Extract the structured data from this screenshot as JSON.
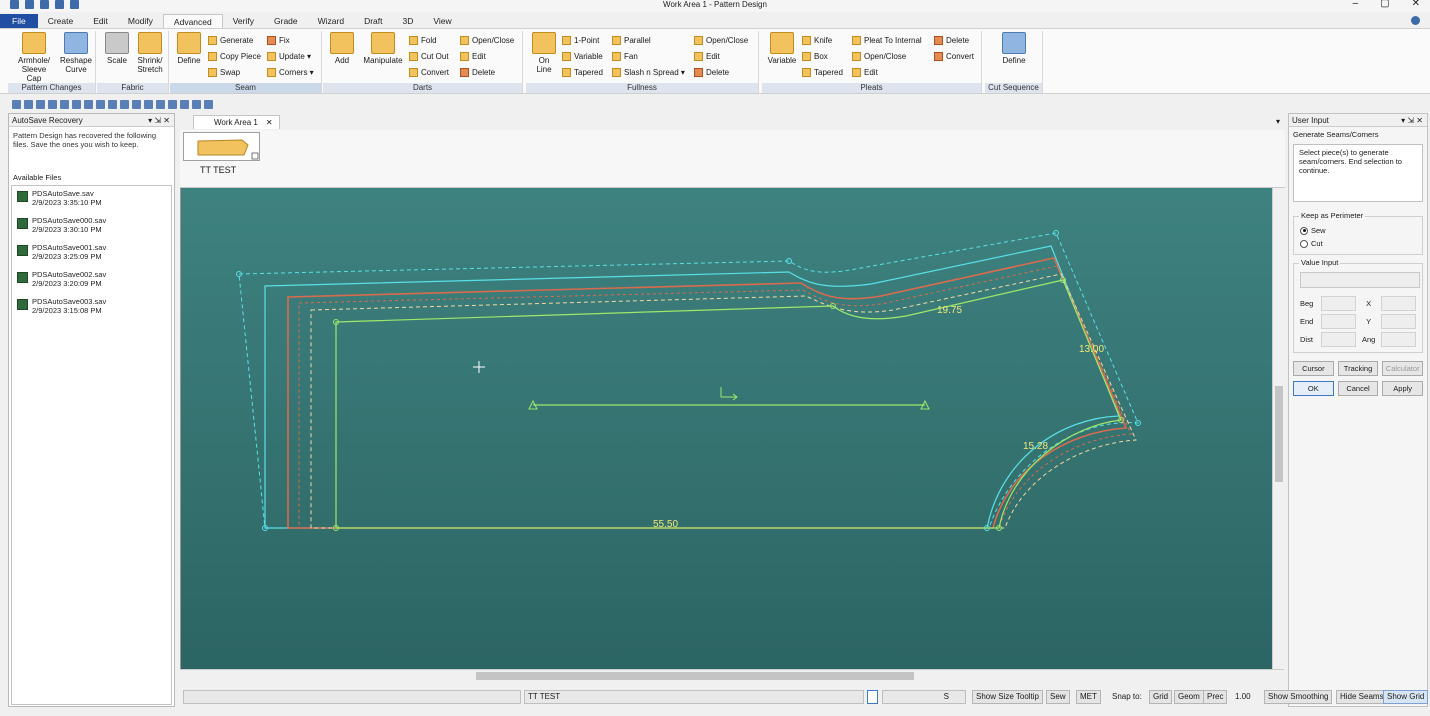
{
  "window": {
    "title": "Work Area 1 - Pattern Design",
    "controls": [
      "–",
      "▢",
      "✕"
    ]
  },
  "ribbon_tabs": [
    "File",
    "Create",
    "Edit",
    "Modify",
    "Advanced",
    "Verify",
    "Grade",
    "Wizard",
    "Draft",
    "3D",
    "View"
  ],
  "active_tab": "Advanced",
  "ribbon": {
    "pattern_changes": {
      "label": "Pattern Changes",
      "armhole": "Armhole/ Sleeve Cap",
      "reshape": "Reshape Curve"
    },
    "fabric": {
      "label": "Fabric",
      "scale": "Scale",
      "shrink": "Shrink/ Stretch"
    },
    "seam": {
      "label": "Seam",
      "define": "Define",
      "generate": "Generate",
      "copy_piece": "Copy Piece",
      "swap": "Swap",
      "fix": "Fix",
      "update": "Update ▾",
      "corners": "Corners ▾"
    },
    "darts": {
      "label": "Darts",
      "add": "Add",
      "manipulate": "Manipulate",
      "fold": "Fold",
      "cut_out": "Cut Out",
      "convert": "Convert",
      "open_close": "Open/Close",
      "edit": "Edit",
      "delete": "Delete"
    },
    "fullness": {
      "label": "Fullness",
      "on_line": "On Line",
      "one_point": "1-Point",
      "variable": "Variable",
      "tapered": "Tapered",
      "parallel": "Parallel",
      "fan": "Fan",
      "slash_spread": "Slash n Spread ▾",
      "open_close": "Open/Close",
      "edit": "Edit",
      "delete": "Delete"
    },
    "pleats": {
      "label": "Pleats",
      "variable": "Variable",
      "knife": "Knife",
      "box": "Box",
      "tapered": "Tapered",
      "pleat_internal": "Pleat To Internal",
      "open_close": "Open/Close",
      "edit": "Edit",
      "delete": "Delete",
      "convert": "Convert"
    },
    "cut_sequence": {
      "label": "Cut Sequence",
      "define": "Define"
    }
  },
  "autosave": {
    "title": "AutoSave Recovery",
    "controls": "▾ ⇲ ✕",
    "message": "Pattern Design has recovered the following files. Save the ones you wish to keep.",
    "available_label": "Available Files",
    "files": [
      {
        "name": "PDSAutoSave.sav",
        "date": "2/9/2023 3:35:10 PM"
      },
      {
        "name": "PDSAutoSave000.sav",
        "date": "2/9/2023 3:30:10 PM"
      },
      {
        "name": "PDSAutoSave001.sav",
        "date": "2/9/2023 3:25:09 PM"
      },
      {
        "name": "PDSAutoSave002.sav",
        "date": "2/9/2023 3:20:09 PM"
      },
      {
        "name": "PDSAutoSave003.sav",
        "date": "2/9/2023 3:15:08 PM"
      }
    ]
  },
  "document": {
    "tab": "Work Area 1",
    "close": "✕",
    "piece_name": "TT TEST"
  },
  "canvas": {
    "measurements": {
      "top": "19.75",
      "side": "13.00",
      "armhole": "15.28",
      "bottom": "55.50"
    },
    "colors": {
      "background": "#3a7c7a",
      "outer": "#59e0e6",
      "seam": "#d96b4e",
      "inner": "#9ee86a"
    }
  },
  "user_input": {
    "title": "User Input",
    "controls": "▾ ⇲ ✕",
    "mode": "Generate Seams/Corners",
    "message": "Select piece(s) to generate seam/corners. End selection to continue.",
    "perimeter_legend": "Keep as Perimeter",
    "options": [
      {
        "label": "Sew",
        "selected": true
      },
      {
        "label": "Cut",
        "selected": false
      }
    ],
    "value_legend": "Value Input",
    "fields": {
      "beg": "Beg",
      "end": "End",
      "dist": "Dist",
      "x": "X",
      "y": "Y",
      "ang": "Ang"
    },
    "buttons": {
      "cursor": "Cursor",
      "tracking": "Tracking",
      "calculator": "Calculator",
      "ok": "OK",
      "cancel": "Cancel",
      "apply": "Apply"
    }
  },
  "statusbar": {
    "piece": "TT TEST",
    "grade_value": "S",
    "show_size_tooltip": "Show Size Tooltip",
    "sew": "Sew",
    "met": "MET",
    "snap_to": "Snap to:",
    "grid": "Grid",
    "geom": "Geom",
    "prec": "Prec",
    "prec_value": "1.00",
    "show_smoothing": "Show Smoothing",
    "hide_seams": "Hide Seams",
    "show_grid": "Show Grid"
  }
}
